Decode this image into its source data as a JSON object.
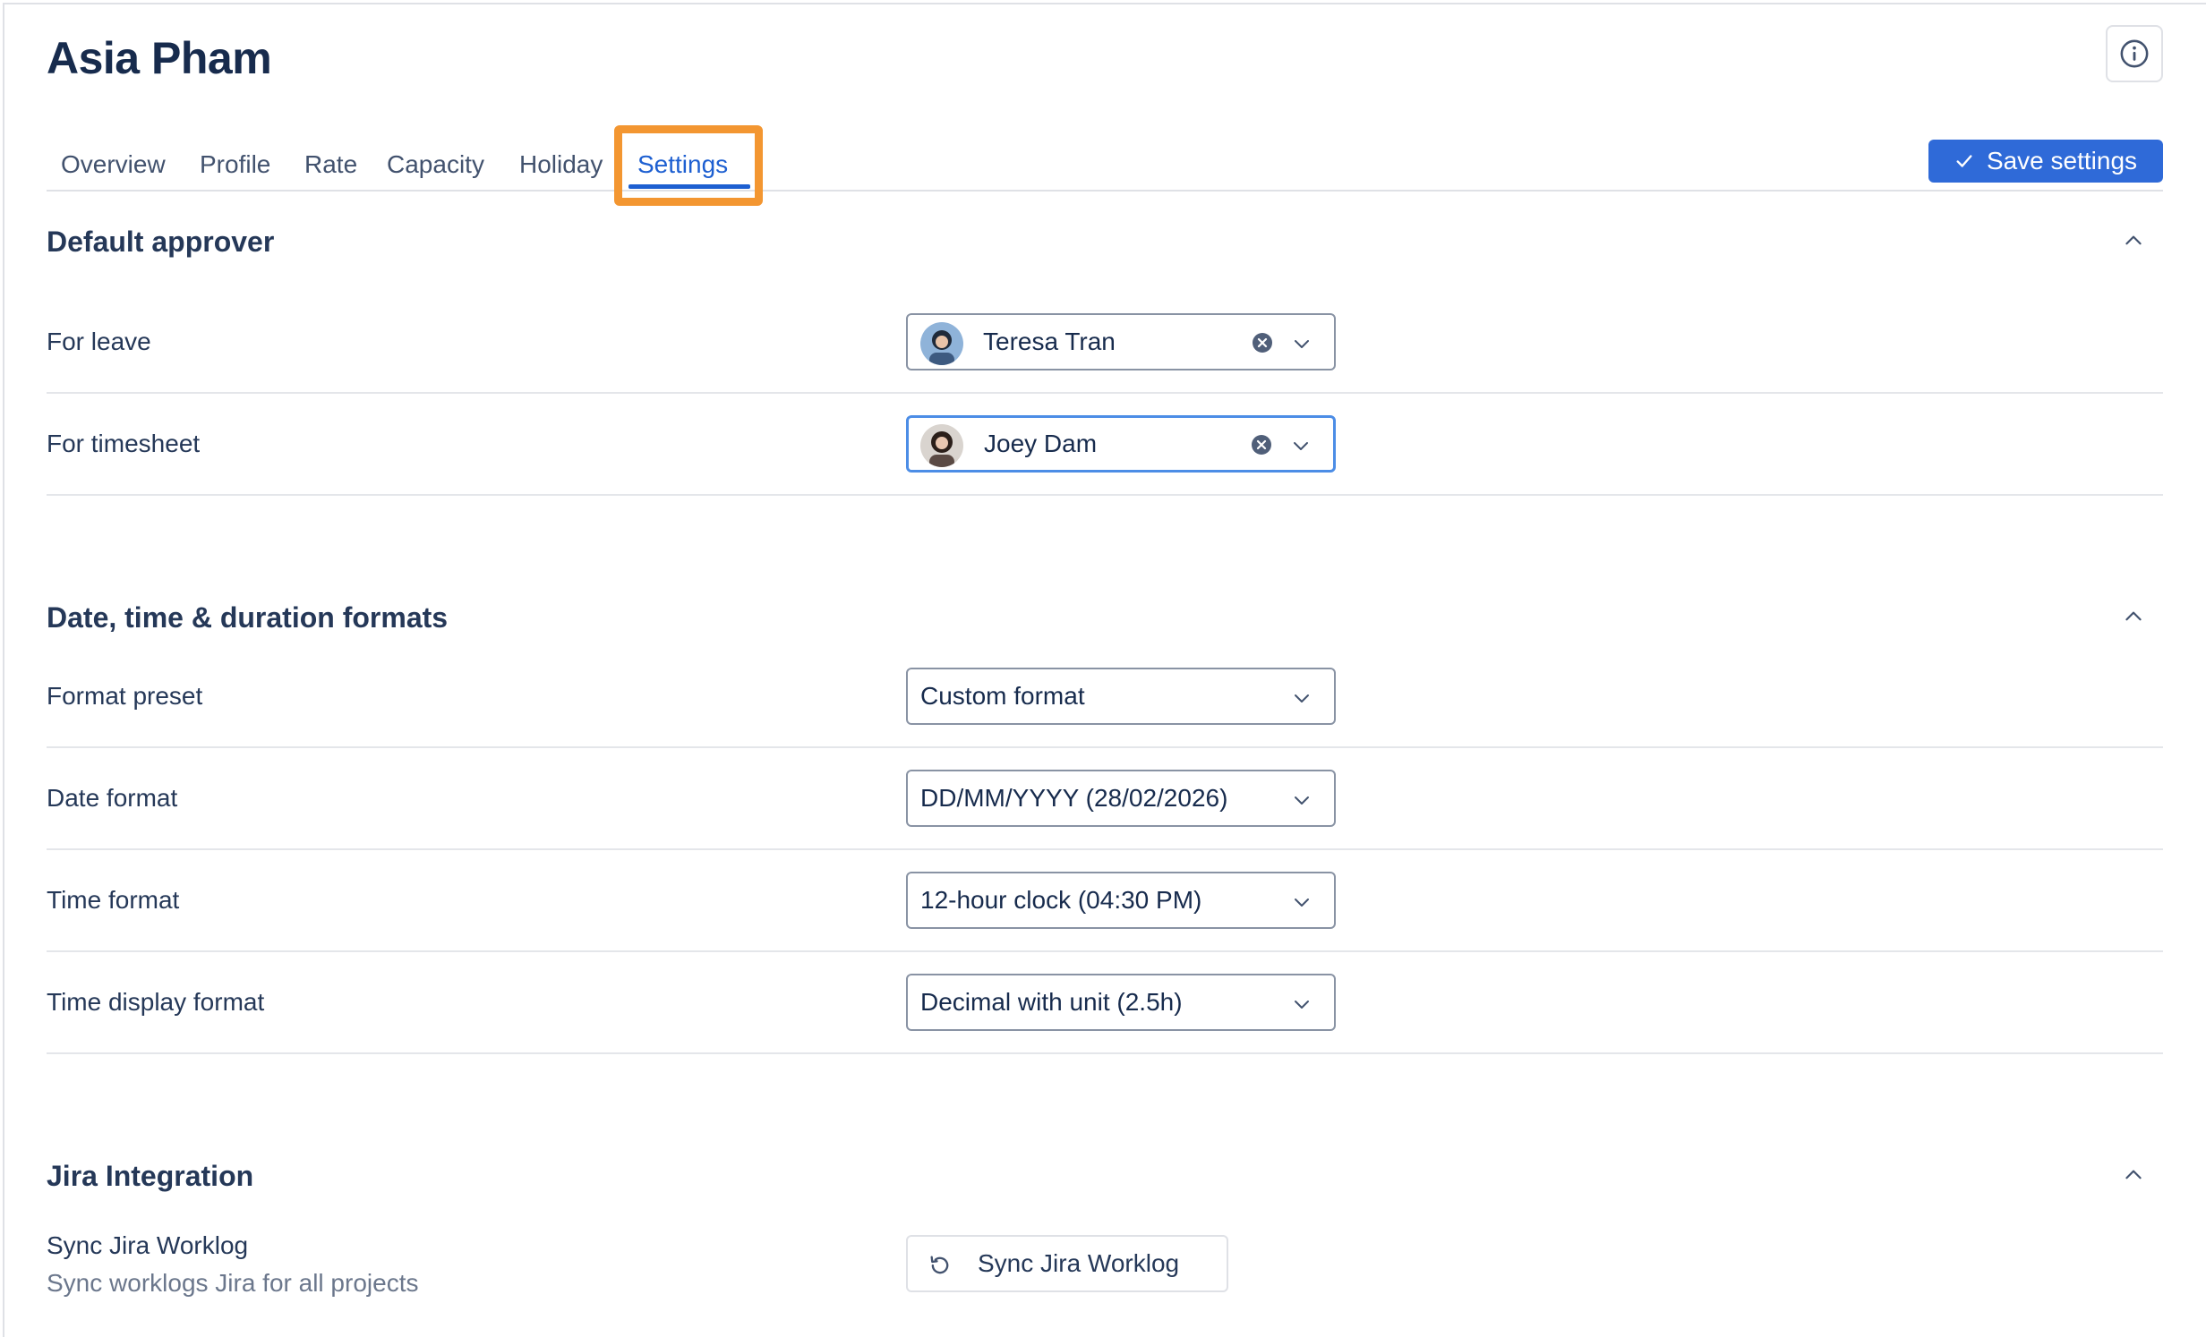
{
  "page": {
    "title": "Asia Pham"
  },
  "tabs": [
    {
      "label": "Overview"
    },
    {
      "label": "Profile"
    },
    {
      "label": "Rate"
    },
    {
      "label": "Capacity"
    },
    {
      "label": "Holiday"
    },
    {
      "label": "Settings",
      "active": true
    }
  ],
  "toolbar": {
    "save_label": "Save settings"
  },
  "sections": {
    "default_approver": {
      "title": "Default approver",
      "for_leave": {
        "label": "For leave",
        "value": "Teresa Tran"
      },
      "for_timesheet": {
        "label": "For timesheet",
        "value": "Joey Dam"
      }
    },
    "formats": {
      "title": "Date, time & duration formats",
      "format_preset": {
        "label": "Format preset",
        "value": "Custom format"
      },
      "date_format": {
        "label": "Date format",
        "value": "DD/MM/YYYY (28/02/2026)"
      },
      "time_format": {
        "label": "Time format",
        "value": "12-hour clock (04:30 PM)"
      },
      "time_display_format": {
        "label": "Time display format",
        "value": "Decimal with unit (2.5h)"
      }
    },
    "jira": {
      "title": "Jira Integration",
      "sync": {
        "label": "Sync Jira Worklog",
        "sublabel": "Sync worklogs Jira for all projects",
        "button_label": "Sync Jira Worklog"
      }
    }
  },
  "colors": {
    "accent": "#1d5fd1",
    "button_bg": "#2f6ad8",
    "highlight": "#f39631",
    "focus_border": "#4c8de6"
  },
  "icons": [
    "info-icon",
    "check-icon",
    "chevron-up-icon",
    "chevron-down-icon",
    "clear-icon",
    "sync-icon"
  ]
}
